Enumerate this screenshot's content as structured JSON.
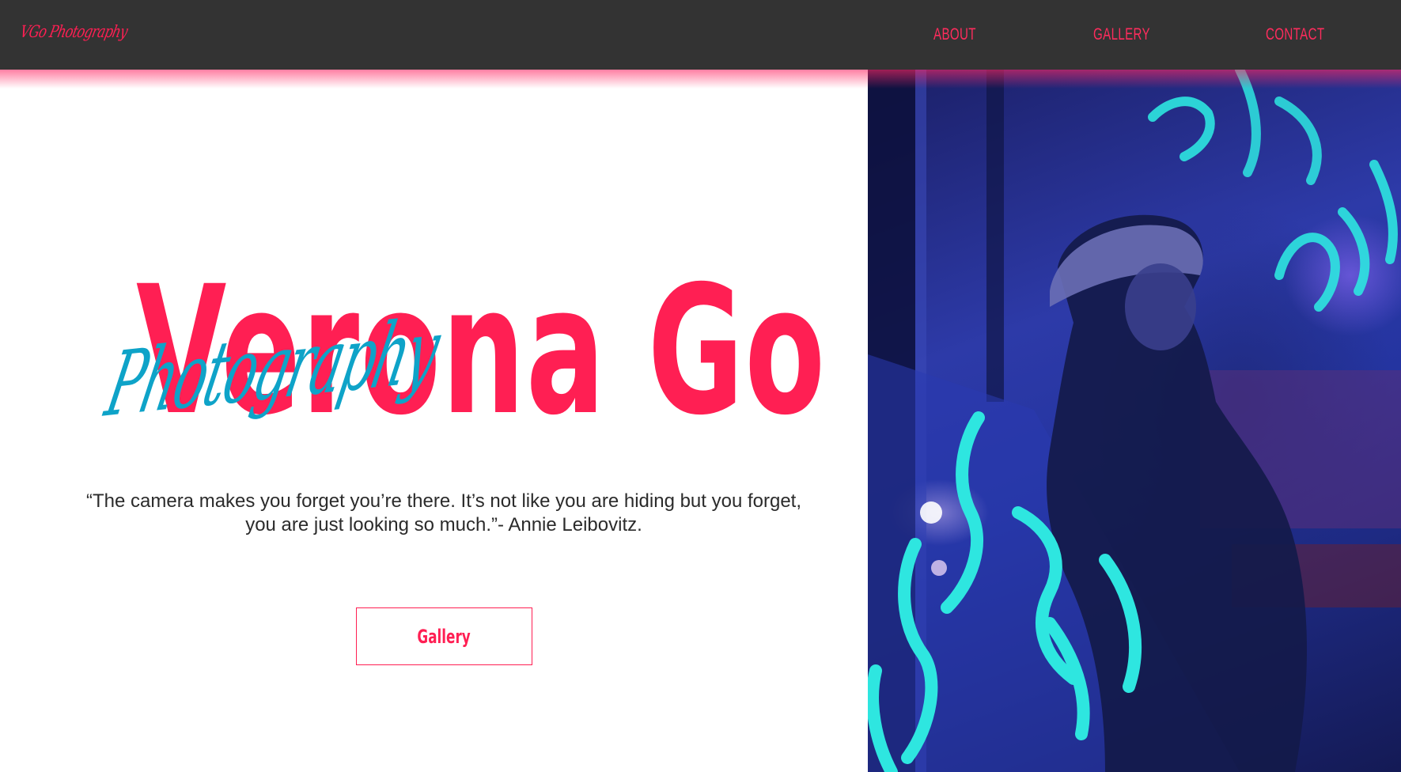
{
  "header": {
    "logo": "VGo Photography",
    "nav": [
      {
        "label": "ABOUT"
      },
      {
        "label": "GALLERY"
      },
      {
        "label": "CONTACT"
      }
    ]
  },
  "hero": {
    "title": "Verona Go",
    "subtitle": "Photography",
    "quote": "“The camera makes you forget you’re there. It’s not like you are hiding but you forget, you are just looking so much.”- Annie Leibovitz.",
    "cta_label": "Gallery"
  },
  "colors": {
    "accent": "#ff1f53",
    "secondary": "#0ea3c8",
    "header_bg": "#333333",
    "neon": "#2ee6e0"
  }
}
